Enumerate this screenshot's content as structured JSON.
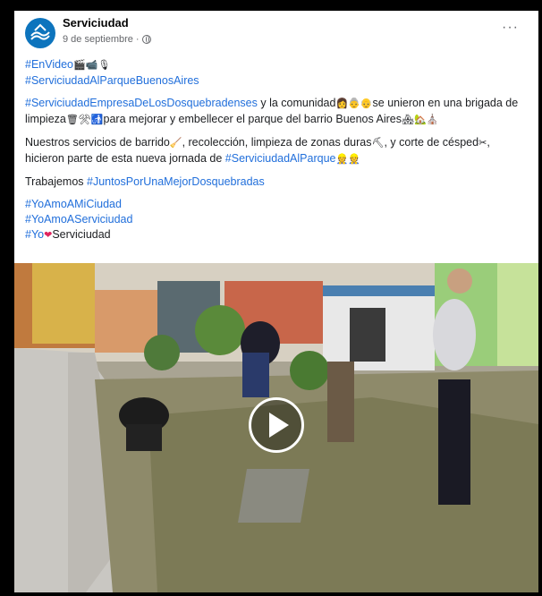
{
  "post": {
    "page_name": "Serviciudad",
    "date": "9 de septiembre",
    "separator": "·",
    "more_label": "···",
    "logo_text": "SERVICIUDAD"
  },
  "lines": {
    "l1": "#EnVideo",
    "l1_emoji": "🎬📹🎙",
    "l2": "#ServiciudadAlParqueBuenosAires",
    "p2_tag": "#ServiciudadEmpresaDeLosDosquebradenses",
    "p2_a": " y la comunidad",
    "p2_emoji1": "👩👵👴",
    "p2_b": "se unieron en una brigada de limpieza",
    "p2_emoji2": "🗑⚒🚮",
    "p2_c": "para mejorar y embellecer el parque del barrio Buenos Aires",
    "p2_emoji3": "🏘🏡⛪",
    "p3_a": "Nuestros servicios de barrido",
    "p3_e1": "🧹",
    "p3_b": ", recolección, limpieza de zonas duras",
    "p3_e2": "⛏",
    "p3_c": ", y corte de césped",
    "p3_e3": "✂",
    "p3_d": ", hicieron parte de esta nueva jornada de ",
    "p3_tag": "#ServiciudadAlParque",
    "p3_e4": "👷👷",
    "p4_a": "Trabajemos ",
    "p4_tag": "#JuntosPorUnaMejorDosquebradas",
    "h1": "#YoAmoAMiCiudad",
    "h2": "#YoAmoAServiciudad",
    "h3_tag": "#Yo",
    "h3_heart": "❤",
    "h3_b": "Serviciudad"
  },
  "media": {
    "type": "video",
    "play_icon": "play-icon"
  },
  "colors": {
    "link": "#216fdb",
    "brand": "#0d74bd",
    "meta": "#65676b"
  }
}
